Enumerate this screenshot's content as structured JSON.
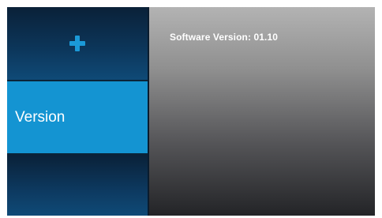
{
  "sidebar": {
    "items": [
      {
        "icon": "plus-icon",
        "label": ""
      },
      {
        "icon": "",
        "label": "Version",
        "selected": true
      },
      {
        "icon": "",
        "label": ""
      }
    ]
  },
  "content": {
    "software_version_text": "Software Version: 01.10"
  },
  "colors": {
    "accent": "#1494d2",
    "sidebar_bg": "#0b2438",
    "text": "#ffffff"
  }
}
